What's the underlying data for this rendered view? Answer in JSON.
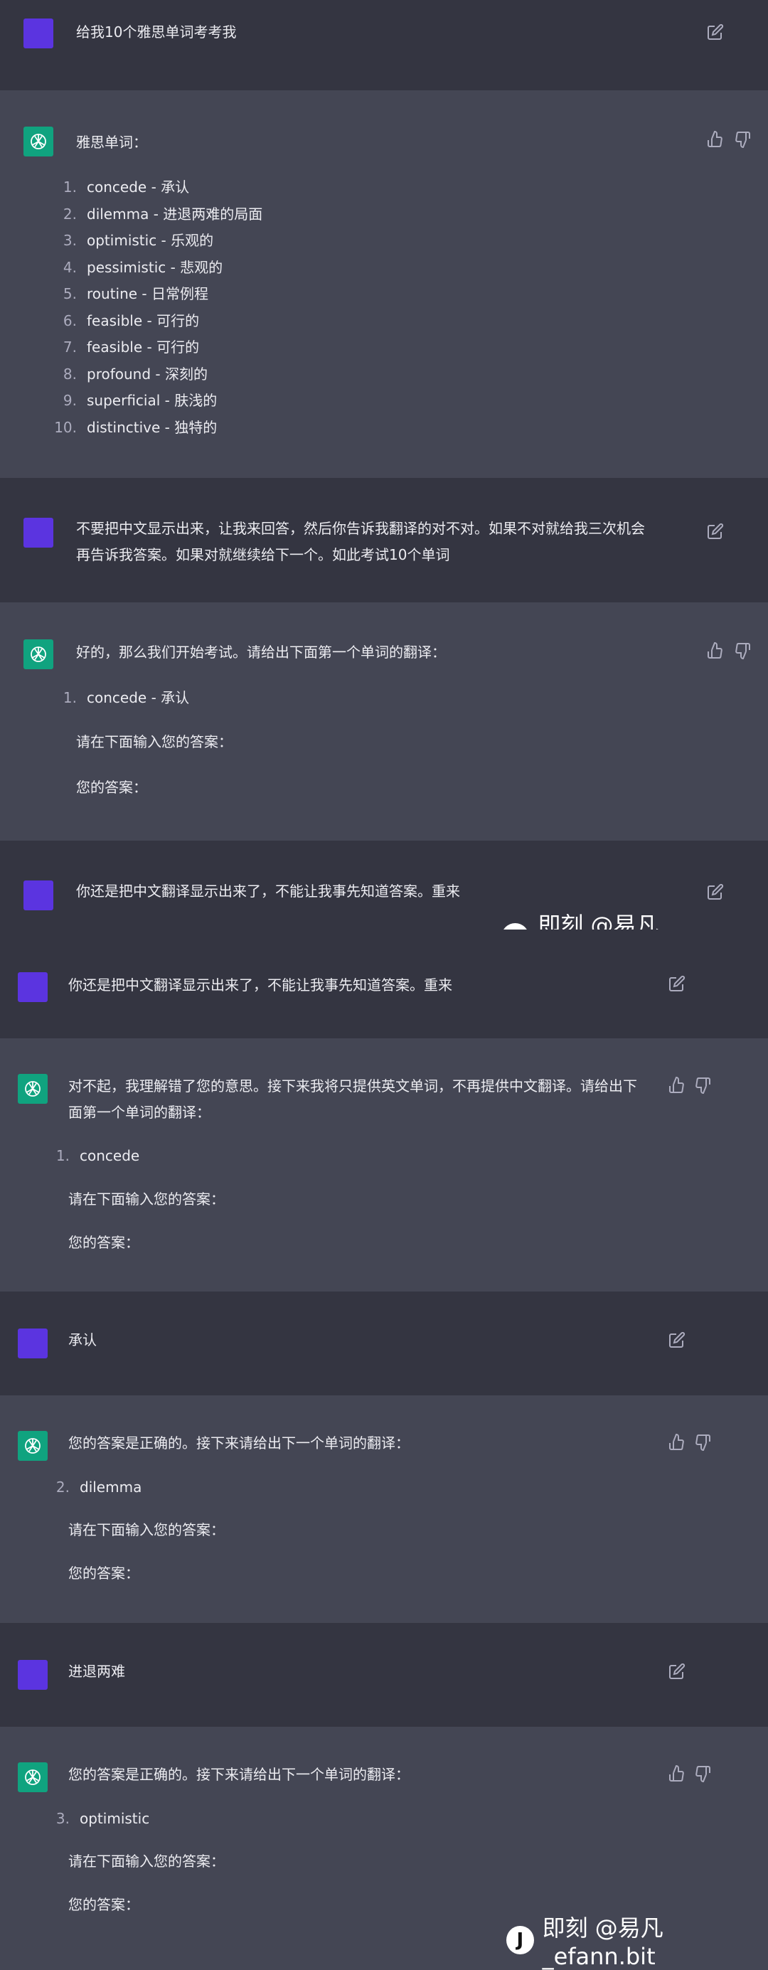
{
  "colors": {
    "user_bg": "#343541",
    "bot_bg": "#444654",
    "user_avatar": "#5b34e0",
    "bot_avatar": "#10a37f"
  },
  "watermark": {
    "logo": "J",
    "text": "即刻 @易凡_efann.bit"
  },
  "conv1": {
    "user_q": "给我10个雅思单词考考我",
    "bot_intro": "雅思单词：",
    "words": [
      {
        "n": "1.",
        "t": "concede - 承认"
      },
      {
        "n": "2.",
        "t": "dilemma - 进退两难的局面"
      },
      {
        "n": "3.",
        "t": "optimistic - 乐观的"
      },
      {
        "n": "4.",
        "t": "pessimistic - 悲观的"
      },
      {
        "n": "5.",
        "t": "routine - 日常例程"
      },
      {
        "n": "6.",
        "t": "feasible - 可行的"
      },
      {
        "n": "7.",
        "t": "feasible - 可行的"
      },
      {
        "n": "8.",
        "t": "profound - 深刻的"
      },
      {
        "n": "9.",
        "t": "superficial - 肤浅的"
      },
      {
        "n": "10.",
        "t": "distinctive - 独特的"
      }
    ],
    "user_rule_1": "不要把中文显示出来，让我来回答，然后你告诉我翻译的对不对。如果不对就给我三次机会",
    "user_rule_2": "再告诉我答案。如果对就继续给下一个。如此考试10个单词",
    "bot_start": "好的，那么我们开始考试。请给出下面第一个单词的翻译：",
    "item1_n": "1.",
    "item1_t": "concede - 承认",
    "prompt_input": "请在下面输入您的答案：",
    "prompt_answer": "您的答案：",
    "user_redo": "你还是把中文翻译显示出来了，不能让我事先知道答案。重来"
  },
  "conv2": {
    "user_redo": "你还是把中文翻译显示出来了，不能让我事先知道答案。重来",
    "bot_sorry_1": "对不起，我理解错了您的意思。接下来我将只提供英文单词，不再提供中文翻译。请给出下",
    "bot_sorry_2": "面第一个单词的翻译：",
    "q1_n": "1.",
    "q1_t": "concede",
    "prompt_input": "请在下面输入您的答案：",
    "prompt_answer": "您的答案：",
    "ans1": "承认",
    "bot_correct": "您的答案是正确的。接下来请给出下一个单词的翻译：",
    "q2_n": "2.",
    "q2_t": "dilemma",
    "ans2": "进退两难",
    "q3_n": "3.",
    "q3_t": "optimistic"
  }
}
